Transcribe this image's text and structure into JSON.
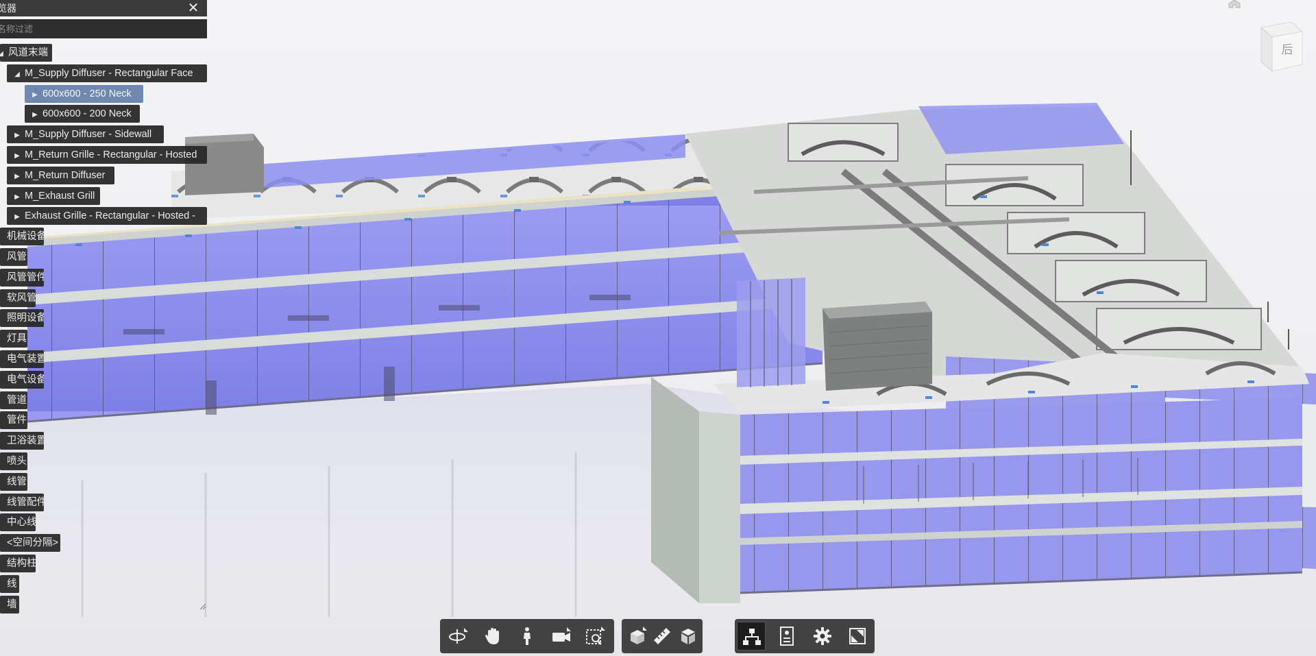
{
  "browser": {
    "title": "览器",
    "close_symbol": "✕",
    "filter_placeholder": "名称过滤",
    "nodes": [
      {
        "label": "风道末端",
        "expander": "◢"
      },
      {
        "label": "M_Supply Diffuser - Rectangular Face",
        "expander": "◢"
      },
      {
        "label": "600x600 - 250 Neck",
        "expander": "▶",
        "selected": true
      },
      {
        "label": "600x600 - 200 Neck",
        "expander": "▶"
      },
      {
        "label": "M_Supply Diffuser - Sidewall",
        "expander": "▶"
      },
      {
        "label": "M_Return Grille - Rectangular - Hosted",
        "expander": "▶"
      },
      {
        "label": "M_Return Diffuser",
        "expander": "▶"
      },
      {
        "label": "M_Exhaust Grill",
        "expander": "▶"
      },
      {
        "label": "Exhaust Grille - Rectangular - Hosted -",
        "expander": "▶"
      },
      {
        "label": "机械设备"
      },
      {
        "label": "风管"
      },
      {
        "label": "风管管件"
      },
      {
        "label": "软风管"
      },
      {
        "label": "照明设备"
      },
      {
        "label": "灯具"
      },
      {
        "label": "电气装置"
      },
      {
        "label": "电气设备"
      },
      {
        "label": "管道"
      },
      {
        "label": "管件"
      },
      {
        "label": "卫浴装置"
      },
      {
        "label": "喷头"
      },
      {
        "label": "线管"
      },
      {
        "label": "线管配件"
      },
      {
        "label": "中心线"
      },
      {
        "label": "<空间分隔>"
      },
      {
        "label": "结构柱"
      },
      {
        "label": "线"
      },
      {
        "label": "墙"
      }
    ]
  },
  "viewcube": {
    "face_label": "后"
  },
  "toolbar": {
    "groups": [
      {
        "buttons": [
          {
            "name": "orbit-button",
            "icon": "orbit-icon",
            "tooltip": ""
          },
          {
            "name": "pan-button",
            "icon": "hand-icon"
          },
          {
            "name": "first-person-button",
            "icon": "person-icon"
          },
          {
            "name": "camera-button",
            "icon": "camera-icon"
          },
          {
            "name": "zoom-window-button",
            "icon": "zoom-window-icon"
          }
        ]
      },
      {
        "buttons": [
          {
            "name": "section-button",
            "icon": "section-box-icon"
          },
          {
            "name": "measure-button",
            "icon": "ruler-icon"
          },
          {
            "name": "explode-button",
            "icon": "cube-icon"
          }
        ]
      },
      {
        "buttons": [
          {
            "name": "model-browser-button",
            "icon": "tree-icon",
            "active": true
          },
          {
            "name": "properties-button",
            "icon": "properties-icon"
          },
          {
            "name": "settings-button",
            "icon": "gear-icon"
          },
          {
            "name": "fullscreen-button",
            "icon": "fullscreen-icon"
          }
        ]
      }
    ]
  },
  "colors": {
    "panel_bg": "#262626",
    "selected_row": "#6f88ad",
    "glass": "#8f8ff0",
    "slab": "#c9cfc9",
    "wall": "#b4bab6",
    "ceiling_beige": "#e9e2c4",
    "toolbar_bg": "#343434"
  }
}
